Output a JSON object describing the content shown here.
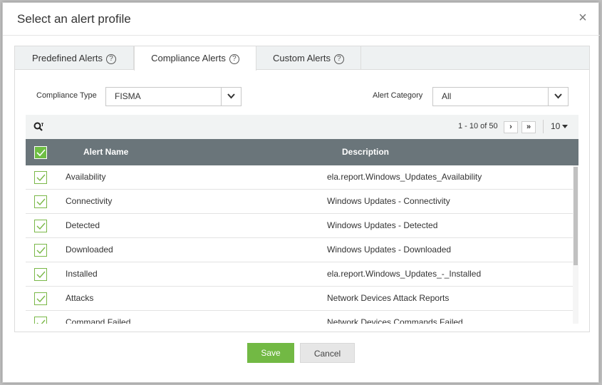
{
  "modal": {
    "title": "Select an alert profile",
    "close_glyph": "×"
  },
  "tabs": [
    {
      "label": "Predefined Alerts",
      "active": false
    },
    {
      "label": "Compliance Alerts",
      "active": true
    },
    {
      "label": "Custom Alerts",
      "active": false
    }
  ],
  "help_glyph": "?",
  "filters": {
    "compliance_type_label": "Compliance Type",
    "compliance_type_value": "FISMA",
    "alert_category_label": "Alert Category",
    "alert_category_value": "All"
  },
  "pager": {
    "range_text": "1 - 10 of 50",
    "next_glyph": "›",
    "last_glyph": "»",
    "page_size": "10"
  },
  "table": {
    "columns": [
      "Alert Name",
      "Description"
    ],
    "rows": [
      {
        "name": "Availability",
        "description": "ela.report.Windows_Updates_Availability",
        "checked": true
      },
      {
        "name": "Connectivity",
        "description": "Windows Updates - Connectivity",
        "checked": true
      },
      {
        "name": "Detected",
        "description": "Windows Updates - Detected",
        "checked": true
      },
      {
        "name": "Downloaded",
        "description": "Windows Updates - Downloaded",
        "checked": true
      },
      {
        "name": "Installed",
        "description": "ela.report.Windows_Updates_-_Installed",
        "checked": true
      },
      {
        "name": "Attacks",
        "description": "Network Devices Attack Reports",
        "checked": true
      },
      {
        "name": "Command Failed",
        "description": "Network Devices Commands Failed",
        "checked": true
      }
    ]
  },
  "buttons": {
    "save": "Save",
    "cancel": "Cancel"
  },
  "colors": {
    "accent_green": "#72b944",
    "header_gray": "#6a757a"
  }
}
